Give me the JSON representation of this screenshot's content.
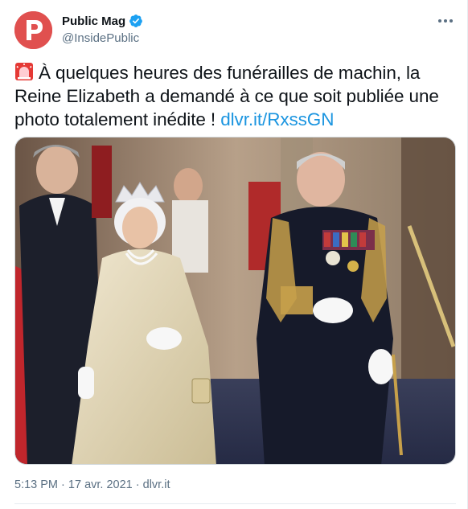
{
  "account": {
    "display_name": "Public Mag",
    "handle": "@InsidePublic",
    "avatar_letter": "P",
    "avatar_color": "#e0504f",
    "verified": true
  },
  "tweet": {
    "emoji": "rotating-light-icon",
    "text_before_link": "À quelques heures des funérailles de machin, la Reine Elizabeth a demandé à ce que soit publiée une photo totalement inédite !",
    "link": "dlvr.it/RxssGN"
  },
  "photo": {
    "subject": "photo"
  },
  "footer": {
    "time": "5:13 PM",
    "separator": "·",
    "date": "17 avr. 2021",
    "source": "dlvr.it"
  },
  "colors": {
    "link": "#1b95e0",
    "secondary_text": "#5b7083",
    "verified_badge": "#1da1f2"
  }
}
